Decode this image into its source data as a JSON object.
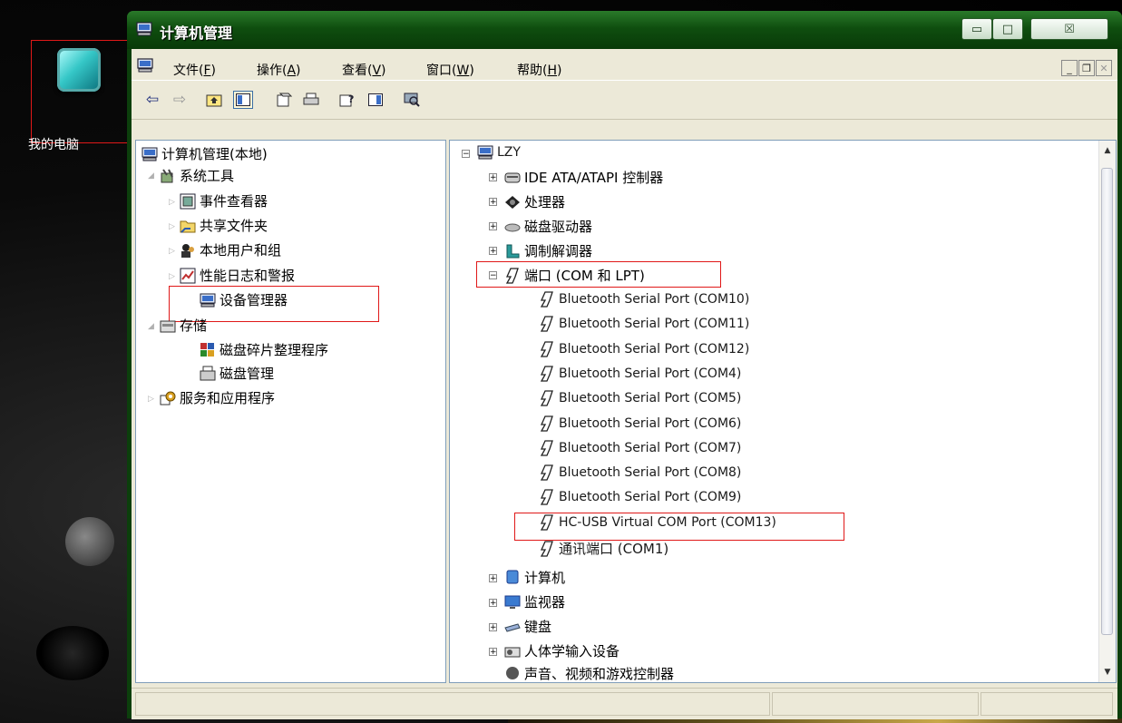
{
  "desktop": {
    "icon_label": "我的电脑"
  },
  "window": {
    "title": "计算机管理",
    "caption_buttons": {
      "min": "▭",
      "max": "□",
      "close": "☒"
    }
  },
  "menu": [
    {
      "label": "文件",
      "key": "F"
    },
    {
      "label": "操作",
      "key": "A"
    },
    {
      "label": "查看",
      "key": "V"
    },
    {
      "label": "窗口",
      "key": "W"
    },
    {
      "label": "帮助",
      "key": "H"
    }
  ],
  "toolbar": [
    "back-icon",
    "forward-icon",
    "up-icon",
    "show-tree-icon",
    "properties-icon",
    "print-icon",
    "help-icon",
    "show-hide-icon",
    "scan-hardware-icon"
  ],
  "left_tree": {
    "root": "计算机管理(本地)",
    "system_tools": "系统工具",
    "event_viewer": "事件查看器",
    "shared_folders": "共享文件夹",
    "local_users": "本地用户和组",
    "perf_logs": "性能日志和警报",
    "device_manager": "设备管理器",
    "storage": "存储",
    "defrag": "磁盘碎片整理程序",
    "disk_mgmt": "磁盘管理",
    "services_apps": "服务和应用程序"
  },
  "right_tree": {
    "root": "LZY",
    "ide": "IDE ATA/ATAPI 控制器",
    "cpu": "处理器",
    "disk": "磁盘驱动器",
    "modem": "调制解调器",
    "ports": "端口 (COM 和 LPT)",
    "ports_children": [
      "Bluetooth Serial Port (COM10)",
      "Bluetooth Serial Port (COM11)",
      "Bluetooth Serial Port (COM12)",
      "Bluetooth Serial Port (COM4)",
      "Bluetooth Serial Port (COM5)",
      "Bluetooth Serial Port (COM6)",
      "Bluetooth Serial Port (COM7)",
      "Bluetooth Serial Port (COM8)",
      "Bluetooth Serial Port (COM9)",
      "HC-USB Virtual COM Port (COM13)",
      "通讯端口 (COM1)"
    ],
    "computer": "计算机",
    "monitor": "监视器",
    "keyboard": "键盘",
    "hid": "人体学输入设备",
    "sound_partial": "声音、视频和游戏控制器"
  },
  "colors": {
    "highlight_box": "#e01818",
    "title_bar": "#0f4e0f"
  }
}
